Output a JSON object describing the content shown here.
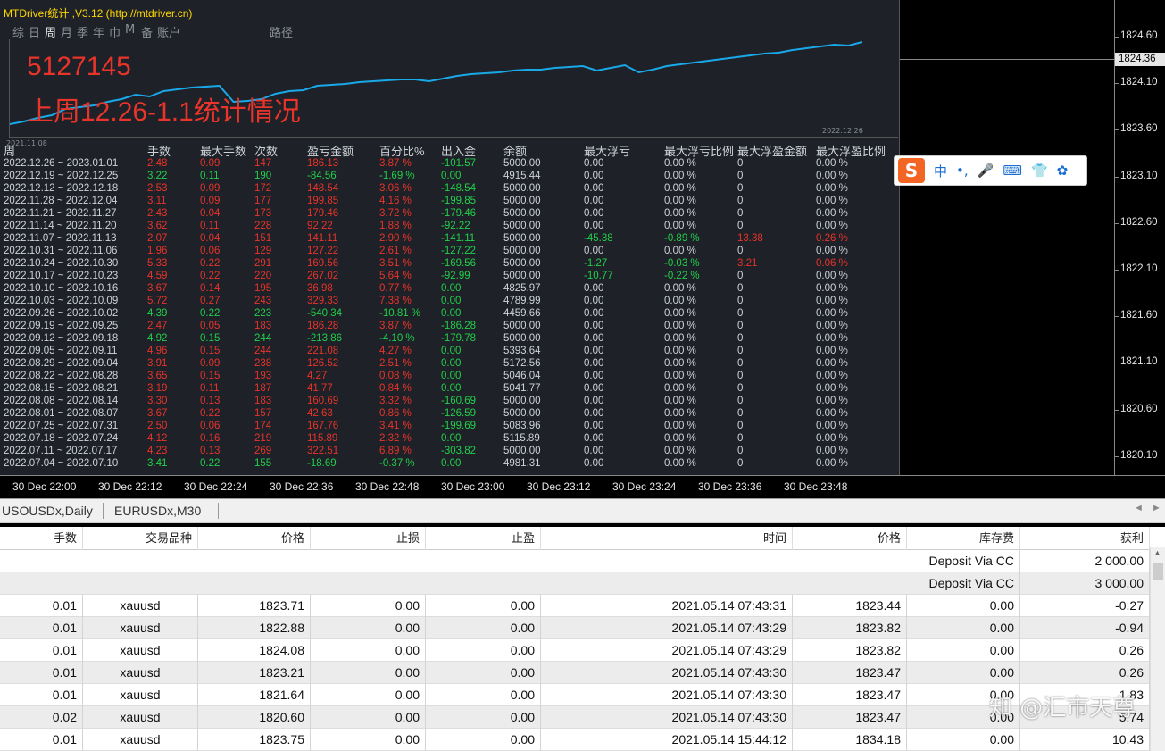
{
  "panel": {
    "title": "MTDriver统计 ,V3.12 (http://mtdriver.cn)",
    "tabs": [
      "综",
      "日",
      "周",
      "月",
      "季",
      "年",
      "巾",
      "M",
      "备",
      "账户"
    ],
    "active_tab": "周",
    "path_tab": "路径",
    "account_number": "5127145",
    "week_title": "上周12.26-1.1统计情况",
    "mini_start_date": "2021.11.08",
    "mini_end_date": "2022.12.26"
  },
  "stats": {
    "headers": [
      "周",
      "手数",
      "最大手数",
      "次数",
      "盈亏金额",
      "百分比%",
      "出入金",
      "余额",
      "最大浮亏",
      "最大浮亏比例",
      "最大浮盈金额",
      "最大浮盈比例"
    ],
    "rows": [
      {
        "week": "2022.12.26 ~ 2023.01.01",
        "lots": "2.48",
        "maxlot": "0.09",
        "count": "147",
        "pnl": "186.13",
        "pct": "3.87 %",
        "flow": "-101.57",
        "bal": "5000.00",
        "maxloss": "0.00",
        "maxlosspct": "0.00 %",
        "maxgain": "0",
        "maxgainpct": "0.00 %",
        "color": "red"
      },
      {
        "week": "2022.12.19 ~ 2022.12.25",
        "lots": "3.22",
        "maxlot": "0.11",
        "count": "190",
        "pnl": "-84.56",
        "pct": "-1.69 %",
        "flow": "0.00",
        "bal": "4915.44",
        "maxloss": "0.00",
        "maxlosspct": "0.00 %",
        "maxgain": "0",
        "maxgainpct": "0.00 %",
        "color": "green"
      },
      {
        "week": "2022.12.12 ~ 2022.12.18",
        "lots": "2.53",
        "maxlot": "0.09",
        "count": "172",
        "pnl": "148.54",
        "pct": "3.06 %",
        "flow": "-148.54",
        "bal": "5000.00",
        "maxloss": "0.00",
        "maxlosspct": "0.00 %",
        "maxgain": "0",
        "maxgainpct": "0.00 %",
        "color": "red"
      },
      {
        "week": "2022.11.28 ~ 2022.12.04",
        "lots": "3.11",
        "maxlot": "0.09",
        "count": "177",
        "pnl": "199.85",
        "pct": "4.16 %",
        "flow": "-199.85",
        "bal": "5000.00",
        "maxloss": "0.00",
        "maxlosspct": "0.00 %",
        "maxgain": "0",
        "maxgainpct": "0.00 %",
        "color": "red"
      },
      {
        "week": "2022.11.21 ~ 2022.11.27",
        "lots": "2.43",
        "maxlot": "0.04",
        "count": "173",
        "pnl": "179.46",
        "pct": "3.72 %",
        "flow": "-179.46",
        "bal": "5000.00",
        "maxloss": "0.00",
        "maxlosspct": "0.00 %",
        "maxgain": "0",
        "maxgainpct": "0.00 %",
        "color": "red"
      },
      {
        "week": "2022.11.14 ~ 2022.11.20",
        "lots": "3.62",
        "maxlot": "0.11",
        "count": "228",
        "pnl": "92.22",
        "pct": "1.88 %",
        "flow": "-92.22",
        "bal": "5000.00",
        "maxloss": "0.00",
        "maxlosspct": "0.00 %",
        "maxgain": "0",
        "maxgainpct": "0.00 %",
        "color": "red"
      },
      {
        "week": "2022.11.07 ~ 2022.11.13",
        "lots": "2.07",
        "maxlot": "0.04",
        "count": "151",
        "pnl": "141.11",
        "pct": "2.90 %",
        "flow": "-141.11",
        "bal": "5000.00",
        "maxloss": "-45.38",
        "maxlosspct": "-0.89 %",
        "maxgain": "13.38",
        "maxgainpct": "0.26 %",
        "color": "red",
        "extra": true
      },
      {
        "week": "2022.10.31 ~ 2022.11.06",
        "lots": "1.96",
        "maxlot": "0.06",
        "count": "129",
        "pnl": "127.22",
        "pct": "2.61 %",
        "flow": "-127.22",
        "bal": "5000.00",
        "maxloss": "0.00",
        "maxlosspct": "0.00 %",
        "maxgain": "0",
        "maxgainpct": "0.00 %",
        "color": "red"
      },
      {
        "week": "2022.10.24 ~ 2022.10.30",
        "lots": "5.33",
        "maxlot": "0.22",
        "count": "291",
        "pnl": "169.56",
        "pct": "3.51 %",
        "flow": "-169.56",
        "bal": "5000.00",
        "maxloss": "-1.27",
        "maxlosspct": "-0.03 %",
        "maxgain": "3.21",
        "maxgainpct": "0.06 %",
        "color": "red",
        "extra": true
      },
      {
        "week": "2022.10.17 ~ 2022.10.23",
        "lots": "4.59",
        "maxlot": "0.22",
        "count": "220",
        "pnl": "267.02",
        "pct": "5.64 %",
        "flow": "-92.99",
        "bal": "5000.00",
        "maxloss": "-10.77",
        "maxlosspct": "-0.22 %",
        "maxgain": "0",
        "maxgainpct": "0.00 %",
        "color": "red",
        "extra2": true
      },
      {
        "week": "2022.10.10 ~ 2022.10.16",
        "lots": "3.67",
        "maxlot": "0.14",
        "count": "195",
        "pnl": "36.98",
        "pct": "0.77 %",
        "flow": "0.00",
        "bal": "4825.97",
        "maxloss": "0.00",
        "maxlosspct": "0.00 %",
        "maxgain": "0",
        "maxgainpct": "0.00 %",
        "color": "red"
      },
      {
        "week": "2022.10.03 ~ 2022.10.09",
        "lots": "5.72",
        "maxlot": "0.27",
        "count": "243",
        "pnl": "329.33",
        "pct": "7.38 %",
        "flow": "0.00",
        "bal": "4789.99",
        "maxloss": "0.00",
        "maxlosspct": "0.00 %",
        "maxgain": "0",
        "maxgainpct": "0.00 %",
        "color": "red"
      },
      {
        "week": "2022.09.26 ~ 2022.10.02",
        "lots": "4.39",
        "maxlot": "0.22",
        "count": "223",
        "pnl": "-540.34",
        "pct": "-10.81 %",
        "flow": "0.00",
        "bal": "4459.66",
        "maxloss": "0.00",
        "maxlosspct": "0.00 %",
        "maxgain": "0",
        "maxgainpct": "0.00 %",
        "color": "green"
      },
      {
        "week": "2022.09.19 ~ 2022.09.25",
        "lots": "2.47",
        "maxlot": "0.05",
        "count": "183",
        "pnl": "186.28",
        "pct": "3.87 %",
        "flow": "-186.28",
        "bal": "5000.00",
        "maxloss": "0.00",
        "maxlosspct": "0.00 %",
        "maxgain": "0",
        "maxgainpct": "0.00 %",
        "color": "red"
      },
      {
        "week": "2022.09.12 ~ 2022.09.18",
        "lots": "4.92",
        "maxlot": "0.15",
        "count": "244",
        "pnl": "-213.86",
        "pct": "-4.10 %",
        "flow": "-179.78",
        "bal": "5000.00",
        "maxloss": "0.00",
        "maxlosspct": "0.00 %",
        "maxgain": "0",
        "maxgainpct": "0.00 %",
        "color": "green"
      },
      {
        "week": "2022.09.05 ~ 2022.09.11",
        "lots": "4.96",
        "maxlot": "0.15",
        "count": "244",
        "pnl": "221.08",
        "pct": "4.27 %",
        "flow": "0.00",
        "bal": "5393.64",
        "maxloss": "0.00",
        "maxlosspct": "0.00 %",
        "maxgain": "0",
        "maxgainpct": "0.00 %",
        "color": "red"
      },
      {
        "week": "2022.08.29 ~ 2022.09.04",
        "lots": "3.91",
        "maxlot": "0.09",
        "count": "238",
        "pnl": "126.52",
        "pct": "2.51 %",
        "flow": "0.00",
        "bal": "5172.56",
        "maxloss": "0.00",
        "maxlosspct": "0.00 %",
        "maxgain": "0",
        "maxgainpct": "0.00 %",
        "color": "red"
      },
      {
        "week": "2022.08.22 ~ 2022.08.28",
        "lots": "3.65",
        "maxlot": "0.15",
        "count": "193",
        "pnl": "4.27",
        "pct": "0.08 %",
        "flow": "0.00",
        "bal": "5046.04",
        "maxloss": "0.00",
        "maxlosspct": "0.00 %",
        "maxgain": "0",
        "maxgainpct": "0.00 %",
        "color": "red"
      },
      {
        "week": "2022.08.15 ~ 2022.08.21",
        "lots": "3.19",
        "maxlot": "0.11",
        "count": "187",
        "pnl": "41.77",
        "pct": "0.84 %",
        "flow": "0.00",
        "bal": "5041.77",
        "maxloss": "0.00",
        "maxlosspct": "0.00 %",
        "maxgain": "0",
        "maxgainpct": "0.00 %",
        "color": "red"
      },
      {
        "week": "2022.08.08 ~ 2022.08.14",
        "lots": "3.30",
        "maxlot": "0.13",
        "count": "183",
        "pnl": "160.69",
        "pct": "3.32 %",
        "flow": "-160.69",
        "bal": "5000.00",
        "maxloss": "0.00",
        "maxlosspct": "0.00 %",
        "maxgain": "0",
        "maxgainpct": "0.00 %",
        "color": "red"
      },
      {
        "week": "2022.08.01 ~ 2022.08.07",
        "lots": "3.67",
        "maxlot": "0.22",
        "count": "157",
        "pnl": "42.63",
        "pct": "0.86 %",
        "flow": "-126.59",
        "bal": "5000.00",
        "maxloss": "0.00",
        "maxlosspct": "0.00 %",
        "maxgain": "0",
        "maxgainpct": "0.00 %",
        "color": "red"
      },
      {
        "week": "2022.07.25 ~ 2022.07.31",
        "lots": "2.50",
        "maxlot": "0.06",
        "count": "174",
        "pnl": "167.76",
        "pct": "3.41 %",
        "flow": "-199.69",
        "bal": "5083.96",
        "maxloss": "0.00",
        "maxlosspct": "0.00 %",
        "maxgain": "0",
        "maxgainpct": "0.00 %",
        "color": "red"
      },
      {
        "week": "2022.07.18 ~ 2022.07.24",
        "lots": "4.12",
        "maxlot": "0.16",
        "count": "219",
        "pnl": "115.89",
        "pct": "2.32 %",
        "flow": "0.00",
        "bal": "5115.89",
        "maxloss": "0.00",
        "maxlosspct": "0.00 %",
        "maxgain": "0",
        "maxgainpct": "0.00 %",
        "color": "red"
      },
      {
        "week": "2022.07.11 ~ 2022.07.17",
        "lots": "4.23",
        "maxlot": "0.13",
        "count": "269",
        "pnl": "322.51",
        "pct": "6.89 %",
        "flow": "-303.82",
        "bal": "5000.00",
        "maxloss": "0.00",
        "maxlosspct": "0.00 %",
        "maxgain": "0",
        "maxgainpct": "0.00 %",
        "color": "red"
      },
      {
        "week": "2022.07.04 ~ 2022.07.10",
        "lots": "3.41",
        "maxlot": "0.22",
        "count": "155",
        "pnl": "-18.69",
        "pct": "-0.37 %",
        "flow": "0.00",
        "bal": "4981.31",
        "maxloss": "0.00",
        "maxlosspct": "0.00 %",
        "maxgain": "0",
        "maxgainpct": "0.00 %",
        "color": "green"
      }
    ]
  },
  "equity_curve": [
    0.05,
    0.08,
    0.12,
    0.15,
    0.22,
    0.24,
    0.26,
    0.3,
    0.33,
    0.38,
    0.36,
    0.42,
    0.44,
    0.46,
    0.47,
    0.48,
    0.3,
    0.31,
    0.33,
    0.39,
    0.42,
    0.43,
    0.48,
    0.49,
    0.5,
    0.52,
    0.53,
    0.54,
    0.55,
    0.55,
    0.53,
    0.56,
    0.59,
    0.61,
    0.62,
    0.63,
    0.65,
    0.66,
    0.66,
    0.68,
    0.69,
    0.7,
    0.65,
    0.68,
    0.71,
    0.63,
    0.66,
    0.7,
    0.72,
    0.74,
    0.76,
    0.78,
    0.8,
    0.82,
    0.84,
    0.85,
    0.88,
    0.9,
    0.92,
    0.94,
    0.93,
    0.97
  ],
  "price_axis": {
    "labels": [
      "1824.60",
      "1824.10",
      "1823.60",
      "1823.10",
      "1822.60",
      "1822.10",
      "1821.60",
      "1821.10",
      "1820.60",
      "1820.10"
    ],
    "current": "1824.36"
  },
  "time_axis": [
    "30 Dec 22:00",
    "30 Dec 22:12",
    "30 Dec 22:24",
    "30 Dec 22:36",
    "30 Dec 22:48",
    "30 Dec 23:00",
    "30 Dec 23:12",
    "30 Dec 23:24",
    "30 Dec 23:36",
    "30 Dec 23:48"
  ],
  "ime": {
    "logo": "S",
    "items": [
      "中",
      "•,",
      "🎤",
      "⌨",
      "👕",
      "✿"
    ]
  },
  "symbol_tabs": [
    "USOUSDx,Daily",
    "EURUSDx,M30"
  ],
  "trade_table": {
    "headers": [
      "手数",
      "交易品种",
      "价格",
      "止损",
      "止盈",
      "时间",
      "价格",
      "库存费",
      "获利"
    ],
    "deposits": [
      {
        "label": "Deposit Via CC",
        "amount": "2 000.00"
      },
      {
        "label": "Deposit Via CC",
        "amount": "3 000.00"
      }
    ],
    "rows": [
      [
        "0.01",
        "xauusd",
        "1823.71",
        "0.00",
        "0.00",
        "2021.05.14 07:43:31",
        "1823.44",
        "0.00",
        "-0.27"
      ],
      [
        "0.01",
        "xauusd",
        "1822.88",
        "0.00",
        "0.00",
        "2021.05.14 07:43:29",
        "1823.82",
        "0.00",
        "-0.94"
      ],
      [
        "0.01",
        "xauusd",
        "1824.08",
        "0.00",
        "0.00",
        "2021.05.14 07:43:29",
        "1823.82",
        "0.00",
        "0.26"
      ],
      [
        "0.01",
        "xauusd",
        "1823.21",
        "0.00",
        "0.00",
        "2021.05.14 07:43:30",
        "1823.47",
        "0.00",
        "0.26"
      ],
      [
        "0.01",
        "xauusd",
        "1821.64",
        "0.00",
        "0.00",
        "2021.05.14 07:43:30",
        "1823.47",
        "0.00",
        "1.83"
      ],
      [
        "0.02",
        "xauusd",
        "1820.60",
        "0.00",
        "0.00",
        "2021.05.14 07:43:30",
        "1823.47",
        "0.00",
        "5.74"
      ],
      [
        "0.01",
        "xauusd",
        "1823.75",
        "0.00",
        "0.00",
        "2021.05.14 15:44:12",
        "1834.18",
        "0.00",
        "10.43"
      ]
    ]
  },
  "watermark": "知 @汇市天尊"
}
